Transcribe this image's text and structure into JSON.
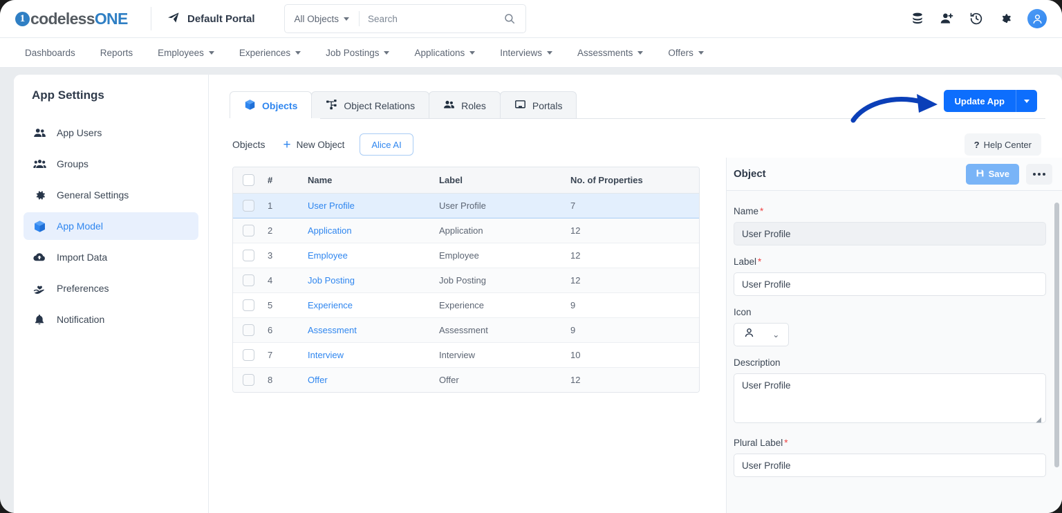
{
  "header": {
    "logo_prefix": "codeless",
    "logo_suffix": "ONE",
    "logo_mark": "1",
    "portal_name": "Default Portal",
    "portal_icon": "send-icon",
    "search_scope": "All Objects",
    "search_placeholder": "Search",
    "search_value": "",
    "icons": [
      {
        "name": "database-icon"
      },
      {
        "name": "add-user-icon"
      },
      {
        "name": "history-icon"
      },
      {
        "name": "settings-gear-icon"
      },
      {
        "name": "user-avatar"
      }
    ]
  },
  "nav": {
    "items": [
      {
        "label": "Dashboards",
        "has_caret": false
      },
      {
        "label": "Reports",
        "has_caret": false
      },
      {
        "label": "Employees",
        "has_caret": true
      },
      {
        "label": "Experiences",
        "has_caret": true
      },
      {
        "label": "Job Postings",
        "has_caret": true
      },
      {
        "label": "Applications",
        "has_caret": true
      },
      {
        "label": "Interviews",
        "has_caret": true
      },
      {
        "label": "Assessments",
        "has_caret": true
      },
      {
        "label": "Offers",
        "has_caret": true
      }
    ]
  },
  "sidebar": {
    "title": "App Settings",
    "items": [
      {
        "label": "App Users",
        "icon": "users-icon",
        "active": false
      },
      {
        "label": "Groups",
        "icon": "group-icon",
        "active": false
      },
      {
        "label": "General Settings",
        "icon": "gear-icon",
        "active": false
      },
      {
        "label": "App Model",
        "icon": "cube-icon",
        "active": true
      },
      {
        "label": "Import Data",
        "icon": "cloud-upload-icon",
        "active": false
      },
      {
        "label": "Preferences",
        "icon": "hand-heart-icon",
        "active": false
      },
      {
        "label": "Notification",
        "icon": "bell-icon",
        "active": false
      }
    ]
  },
  "tabs": [
    {
      "label": "Objects",
      "icon": "cube-icon",
      "active": true
    },
    {
      "label": "Object Relations",
      "icon": "relations-icon",
      "active": false
    },
    {
      "label": "Roles",
      "icon": "users-icon",
      "active": false
    },
    {
      "label": "Portals",
      "icon": "monitor-icon",
      "active": false
    }
  ],
  "update_button": {
    "label": "Update App",
    "color": "#0d6efd"
  },
  "annotation": {
    "arrow": "curved-arrow-pointing-to-update-app"
  },
  "toolbar": {
    "title": "Objects",
    "new_object_label": "New Object",
    "alice_ai_label": "Alice AI",
    "help_center_label": "Help Center",
    "help_marker": "?"
  },
  "table": {
    "columns": [
      "",
      "#",
      "Name",
      "Label",
      "No. of Properties"
    ],
    "rows": [
      {
        "num": "1",
        "name": "User Profile",
        "label": "User Profile",
        "props": "7",
        "selected": true
      },
      {
        "num": "2",
        "name": "Application",
        "label": "Application",
        "props": "12",
        "selected": false
      },
      {
        "num": "3",
        "name": "Employee",
        "label": "Employee",
        "props": "12",
        "selected": false
      },
      {
        "num": "4",
        "name": "Job Posting",
        "label": "Job Posting",
        "props": "12",
        "selected": false
      },
      {
        "num": "5",
        "name": "Experience",
        "label": "Experience",
        "props": "9",
        "selected": false
      },
      {
        "num": "6",
        "name": "Assessment",
        "label": "Assessment",
        "props": "9",
        "selected": false
      },
      {
        "num": "7",
        "name": "Interview",
        "label": "Interview",
        "props": "10",
        "selected": false
      },
      {
        "num": "8",
        "name": "Offer",
        "label": "Offer",
        "props": "12",
        "selected": false
      }
    ]
  },
  "detail": {
    "title": "Object",
    "save_label": "Save",
    "more_label": "",
    "fields": {
      "name_label": "Name",
      "name_value": "User Profile",
      "label_label": "Label",
      "label_value": "User Profile",
      "icon_label": "Icon",
      "icon_value": "person-icon",
      "description_label": "Description",
      "description_value": "User Profile",
      "plural_label": "Plural Label",
      "plural_value": "User Profile"
    }
  },
  "colors": {
    "accent": "#2f86ef",
    "primary_button": "#0d6efd",
    "save_button": "#79b4f7",
    "required_star": "#ef4444",
    "page_bg": "#e9ecef",
    "selected_row": "#e3effd"
  }
}
